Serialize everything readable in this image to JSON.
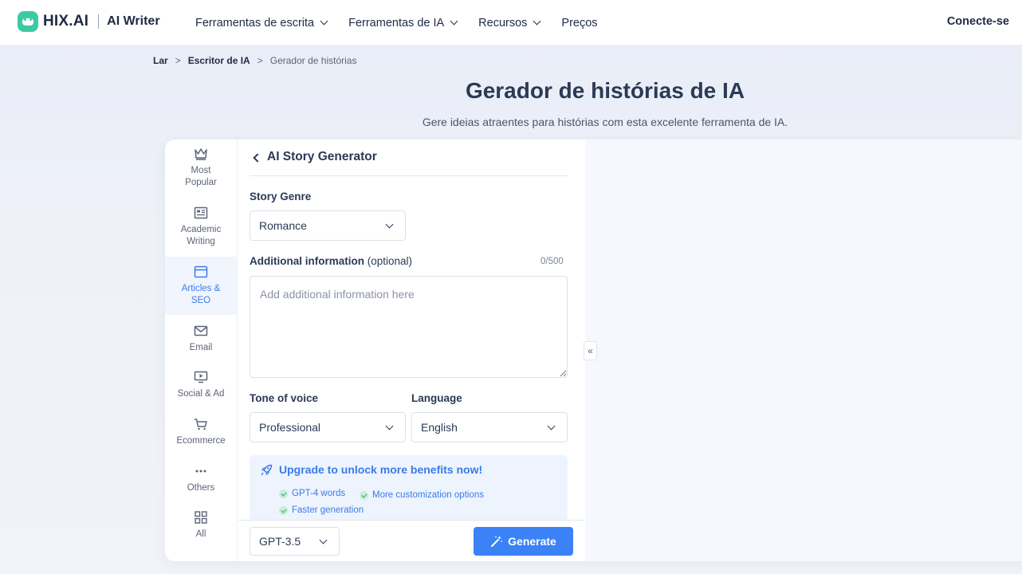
{
  "brand": {
    "name": "HIX.AI",
    "product": "AI Writer"
  },
  "nav": {
    "items": [
      {
        "label": "Ferramentas de escrita",
        "dropdown": true
      },
      {
        "label": "Ferramentas de IA",
        "dropdown": true
      },
      {
        "label": "Recursos",
        "dropdown": true
      },
      {
        "label": "Preços",
        "dropdown": false
      }
    ],
    "signin": "Conecte-se"
  },
  "breadcrumb": {
    "home": "Lar",
    "parent": "Escritor de IA",
    "current": "Gerador de histórias",
    "separator": ">"
  },
  "page": {
    "title": "Gerador de histórias de IA",
    "subtitle": "Gere ideias atraentes para histórias com esta excelente ferramenta de IA."
  },
  "sidebar": {
    "items": [
      {
        "line1": "Most",
        "line2": "Popular",
        "icon": "crown-icon"
      },
      {
        "line1": "Academic",
        "line2": "Writing",
        "icon": "newspaper-icon"
      },
      {
        "line1": "Articles &",
        "line2": "SEO",
        "icon": "browser-window-icon",
        "active": true
      },
      {
        "line1": "Email",
        "line2": "",
        "icon": "mail-icon"
      },
      {
        "line1": "Social & Ad",
        "line2": "",
        "icon": "monitor-play-icon"
      },
      {
        "line1": "Ecommerce",
        "line2": "",
        "icon": "cart-icon"
      },
      {
        "line1": "Others",
        "line2": "",
        "icon": "more-dots-icon"
      },
      {
        "line1": "All",
        "line2": "",
        "icon": "grid-icon"
      }
    ]
  },
  "form": {
    "title": "AI Story Generator",
    "genre": {
      "label": "Story Genre",
      "value": "Romance"
    },
    "additional": {
      "label": "Additional information",
      "optional": "(optional)",
      "counter": "0/500",
      "placeholder": "Add additional information here",
      "value": ""
    },
    "tone": {
      "label": "Tone of voice",
      "value": "Professional"
    },
    "language": {
      "label": "Language",
      "value": "English"
    },
    "upgrade": {
      "title": "Upgrade to unlock more benefits now!",
      "benefits": [
        "GPT-4 words",
        "More customization options",
        "Faster generation"
      ]
    },
    "model": {
      "value": "GPT-3.5"
    },
    "generate": "Generate"
  },
  "output": {
    "collapse": "«"
  },
  "colors": {
    "accent": "#3b82f6",
    "brand": "#3dc9a5",
    "active_bg": "#f1f5fd",
    "upgrade_bg": "#eef4fd"
  }
}
